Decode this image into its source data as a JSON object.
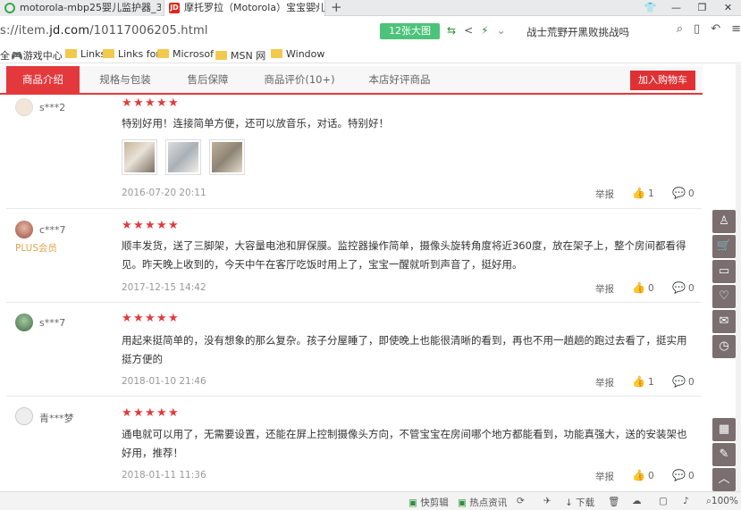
{
  "browser": {
    "tabs": [
      {
        "title": "motorola-mbp25婴儿监护器_3",
        "active": false
      },
      {
        "title": "摩托罗拉（Motorola）宝宝婴儿",
        "active": true
      }
    ],
    "new_tab": "+",
    "window_buttons": [
      "👕",
      "—",
      "❐",
      "✕"
    ],
    "url_prefix": "s://item.",
    "url_domain": "jd.com",
    "url_path": "/10117006205.html",
    "image_count": "12张大图",
    "search_text": "战士荒野开黑败挑战吗",
    "bookmarks": [
      "游戏中心",
      "Links",
      "Links for",
      "Microsof",
      "MSN 网",
      "Window"
    ]
  },
  "product_nav": {
    "tabs": [
      "商品介绍",
      "规格与包装",
      "售后保障",
      "商品评价(10+)",
      "本店好评商品"
    ],
    "cart_button": "加入购物车"
  },
  "reviews": [
    {
      "user": "s***2",
      "badge": "",
      "text": "特别好用！连接简单方便，还可以放音乐，对话。特别好！",
      "date": "2016-07-20 20:11",
      "report": "举报",
      "likes": "1",
      "comments": "0",
      "has_images": true
    },
    {
      "user": "c***7",
      "badge": "PLUS会员",
      "text": "顺丰发货，送了三脚架，大容量电池和屏保膜。监控器操作简单，摄像头旋转角度将近360度，放在架子上，整个房间都看得见。昨天晚上收到的，今天中午在客厅吃饭时用上了，宝宝一醒就听到声音了，挺好用。",
      "date": "2017-12-15 14:42",
      "report": "举报",
      "likes": "0",
      "comments": "0",
      "has_images": false
    },
    {
      "user": "s***7",
      "badge": "",
      "text": "用起来挺简单的，没有想象的那么复杂。孩子分屋睡了，即使晚上也能很清晰的看到，再也不用一趟趟的跑过去看了，挺实用挺方便的",
      "date": "2018-01-10 21:46",
      "report": "举报",
      "likes": "1",
      "comments": "0",
      "has_images": false
    },
    {
      "user": "青***梦",
      "badge": "",
      "text": "通电就可以用了，无需要设置，还能在屏上控制摄像头方向，不管宝宝在房间哪个地方都能看到，功能真强大，送的安装架也好用，推荐！",
      "date": "2018-01-11 11:36",
      "report": "举报",
      "likes": "0",
      "comments": "0",
      "has_images": false
    }
  ],
  "status_bar": {
    "items": [
      "快剪辑",
      "热点资讯",
      "下载",
      "100%"
    ]
  },
  "colors": {
    "jd_red": "#e4393c",
    "star": "#e4393c",
    "plus_gold": "#e3a44d",
    "sidebar": "#7a6e6e",
    "image_badge": "#4cc37a"
  }
}
